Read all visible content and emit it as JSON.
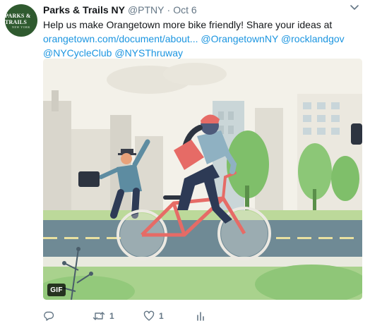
{
  "account": {
    "name": "Parks & Trails NY",
    "handle": "@PTNY",
    "separator": "·",
    "date": "Oct 6",
    "avatar": {
      "line1": "PARKS & TRAILS",
      "line2": "NEW YORK",
      "bg": "#2f5a2f"
    }
  },
  "tweet": {
    "text_plain": "Help us make Orangetown more bike friendly! Share your ideas at",
    "link_url": "orangetown.com/document/about...",
    "mentions": [
      "@OrangetownNY",
      "@rocklandgov",
      "@NYCycleClub",
      "@NYSThruway"
    ]
  },
  "media": {
    "badge": "GIF"
  },
  "actions": {
    "reply_count": "",
    "retweet_count": "1",
    "like_count": "1",
    "analytics_count": ""
  },
  "colors": {
    "link": "#1b95e0",
    "muted": "#657786",
    "text": "#14171a"
  }
}
